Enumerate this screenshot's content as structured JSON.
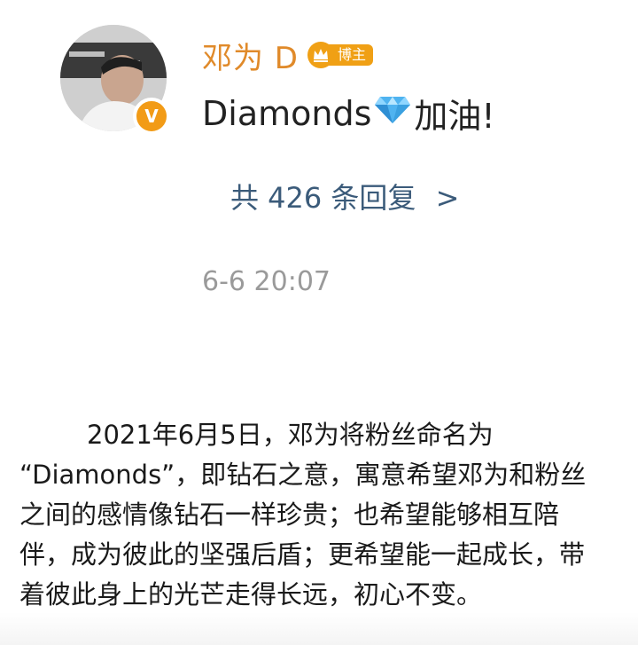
{
  "comment": {
    "username": "邓为 D",
    "badge_label": "博主",
    "text": "Diamonds",
    "text_suffix": "加油!",
    "replies_link": "共 426 条回复",
    "replies_chevron": ">",
    "timestamp": "6-6  20:07",
    "verified_mark": "V",
    "colors": {
      "username": "#e08a2a",
      "badge": "#f0a015",
      "replies": "#3b5b7a",
      "timestamp": "#9a9a9a",
      "diamond": "#4fb3f0"
    },
    "icons": {
      "avatar": "avatar-image",
      "verified": "verified-v-icon",
      "crown": "crown-icon",
      "diamond": "diamond-emoji-icon"
    }
  },
  "article": {
    "lines": [
      "2021年6月5日，邓为将粉丝命名为",
      "“Diamonds”，即钻石之意，寓意希望邓为和粉丝",
      "之间的感情像钻石一样珍贵；也希望能够相互陪",
      "伴，成为彼此的坚强后盾；更希望能一起成长，带",
      "着彼此身上的光芒走得长远，初心不变。"
    ]
  }
}
